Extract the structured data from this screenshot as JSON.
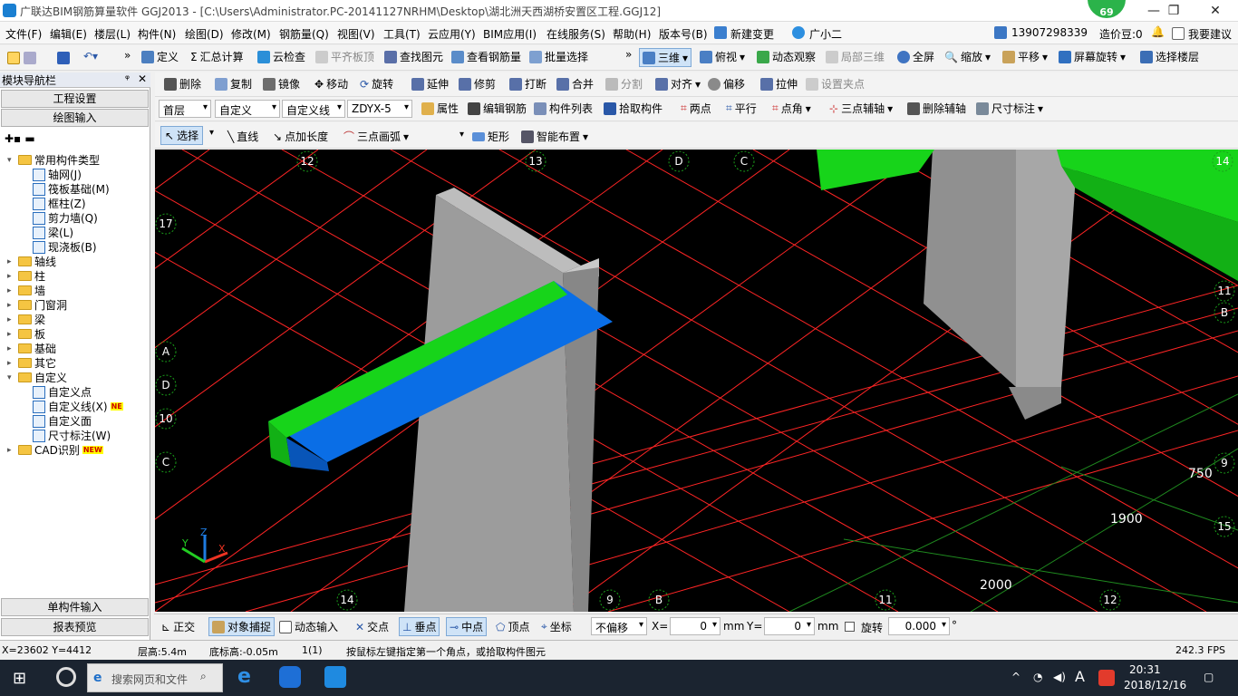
{
  "window": {
    "title": "广联达BIM钢筋算量软件 GGJ2013 - [C:\\Users\\Administrator.PC-20141127NRHM\\Desktop\\湖北洲天西湖桥安置区工程.GGJ12]",
    "badge": "69",
    "min": "—",
    "max": "❐",
    "close": "✕"
  },
  "menu": [
    "文件(F)",
    "编辑(E)",
    "楼层(L)",
    "构件(N)",
    "绘图(D)",
    "修改(M)",
    "钢筋量(Q)",
    "视图(V)",
    "工具(T)",
    "云应用(Y)",
    "BIM应用(I)",
    "在线服务(S)",
    "帮助(H)",
    "版本号(B)",
    "新建变更",
    "广小二"
  ],
  "menu_right": {
    "phone": "13907298339",
    "beans": "造价豆:0",
    "suggest": "我要建议"
  },
  "toolbar1": {
    "items": [
      "定义",
      "汇总计算",
      "云检查",
      "平齐板顶",
      "查找图元",
      "查看钢筋量",
      "批量选择"
    ],
    "view": [
      "三维",
      "俯视",
      "动态观察",
      "局部三维",
      "全屏",
      "缩放",
      "平移",
      "屏幕旋转",
      "选择楼层"
    ]
  },
  "toolbar2": [
    "删除",
    "复制",
    "镜像",
    "移动",
    "旋转",
    "延伸",
    "修剪",
    "打断",
    "合并",
    "分割",
    "对齐",
    "偏移",
    "拉伸",
    "设置夹点"
  ],
  "toolbar3": {
    "floor": "首层",
    "type": "自定义",
    "sub": "自定义线",
    "name": "ZDYX-5",
    "items": [
      "属性",
      "编辑钢筋",
      "构件列表",
      "拾取构件",
      "两点",
      "平行",
      "点角",
      "三点辅轴",
      "删除辅轴",
      "尺寸标注"
    ]
  },
  "toolbar4": [
    "选择",
    "直线",
    "点加长度",
    "三点画弧",
    "矩形",
    "智能布置"
  ],
  "panel": {
    "title": "模块导航栏",
    "pin": "ᵠ",
    "close": "✕",
    "project_settings": "工程设置",
    "drawing_input": "绘图输入",
    "single_input": "单构件输入",
    "report": "报表预览"
  },
  "tree": [
    {
      "label": "常用构件类型",
      "level": 0,
      "exp": "▾",
      "folder": true
    },
    {
      "label": "轴网(J)",
      "level": 1
    },
    {
      "label": "筏板基础(M)",
      "level": 1
    },
    {
      "label": "框柱(Z)",
      "level": 1
    },
    {
      "label": "剪力墙(Q)",
      "level": 1
    },
    {
      "label": "梁(L)",
      "level": 1
    },
    {
      "label": "现浇板(B)",
      "level": 1
    },
    {
      "label": "轴线",
      "level": 0,
      "exp": "▸",
      "folder": true
    },
    {
      "label": "柱",
      "level": 0,
      "exp": "▸",
      "folder": true
    },
    {
      "label": "墙",
      "level": 0,
      "exp": "▸",
      "folder": true
    },
    {
      "label": "门窗洞",
      "level": 0,
      "exp": "▸",
      "folder": true
    },
    {
      "label": "梁",
      "level": 0,
      "exp": "▸",
      "folder": true
    },
    {
      "label": "板",
      "level": 0,
      "exp": "▸",
      "folder": true
    },
    {
      "label": "基础",
      "level": 0,
      "exp": "▸",
      "folder": true
    },
    {
      "label": "其它",
      "level": 0,
      "exp": "▸",
      "folder": true
    },
    {
      "label": "自定义",
      "level": 0,
      "exp": "▾",
      "folder": true
    },
    {
      "label": "自定义点",
      "level": 1
    },
    {
      "label": "自定义线(X)",
      "level": 1,
      "badge": "NE"
    },
    {
      "label": "自定义面",
      "level": 1
    },
    {
      "label": "尺寸标注(W)",
      "level": 1
    },
    {
      "label": "CAD识别",
      "level": 0,
      "exp": "▸",
      "folder": true,
      "badge": "NEW"
    }
  ],
  "axis_labels": [
    "12",
    "13",
    "D",
    "C",
    "14",
    "17",
    "11",
    "B",
    "A",
    "D",
    "10",
    "C",
    "9",
    "15",
    "14",
    "9",
    "B",
    "11",
    "12",
    "13"
  ],
  "dims": [
    "750",
    "1900",
    "2000"
  ],
  "axes_gizmo": {
    "x": "X",
    "y": "Y",
    "z": "Z"
  },
  "snap": {
    "items": [
      "正交",
      "对象捕捉",
      "动态输入",
      "交点",
      "垂点",
      "中点",
      "顶点",
      "坐标"
    ],
    "offset": "不偏移",
    "x_label": "X=",
    "x_val": "0",
    "y_label": "Y=",
    "y_val": "0",
    "unit": "mm",
    "rotate": "旋转",
    "rot_val": "0.000",
    "deg": "°"
  },
  "status": {
    "coords": "X=23602 Y=4412",
    "floor_h": "层高:5.4m",
    "bottom": "底标高:-0.05m",
    "count": "1(1)",
    "hint": "按鼠标左键指定第一个角点，或拾取构件图元",
    "fps": "242.3 FPS"
  },
  "taskbar": {
    "search": "搜索网页和文件",
    "time": "20:31",
    "date": "2018/12/16",
    "ime": "A"
  },
  "colors": {
    "green": "#17d41a",
    "blue": "#0a6ee6",
    "wall": "#9c9c9c",
    "grid": "#ff2020",
    "dim": "#1aa01a"
  }
}
